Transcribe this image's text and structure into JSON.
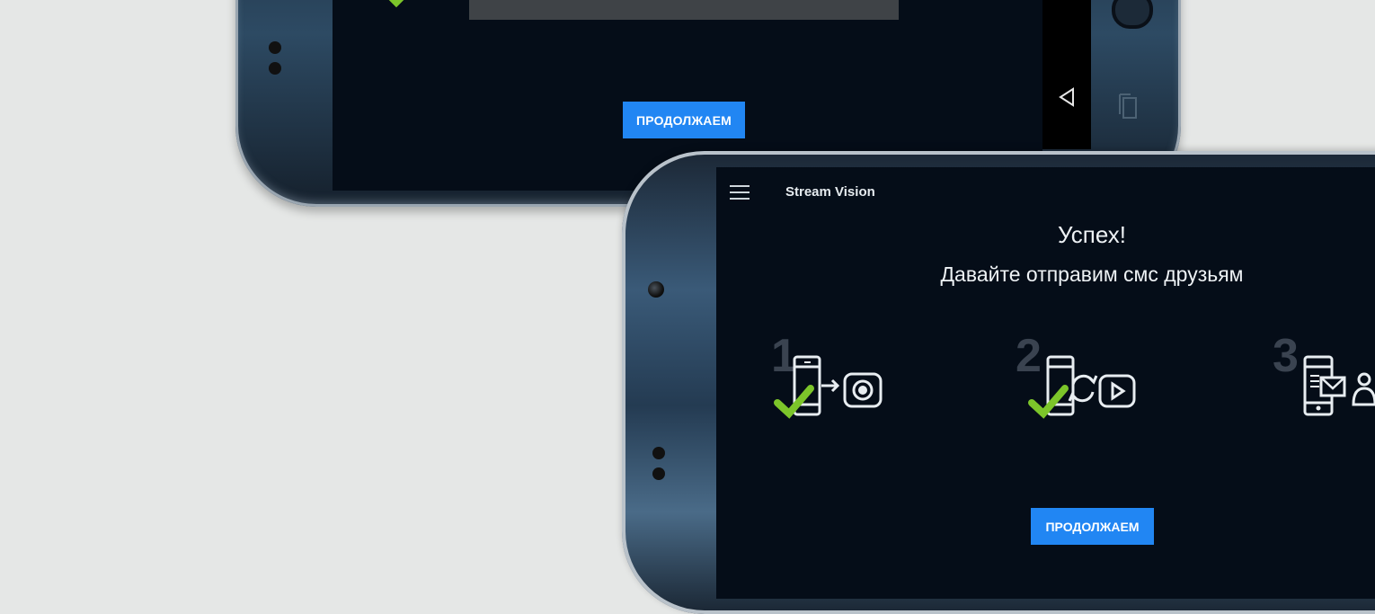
{
  "back_phone": {
    "continue_label": "ПРОДОЛЖАЕМ"
  },
  "front_phone": {
    "app_title": "Stream Vision",
    "heading": "Успех!",
    "subheading": "Давайте отправим смс друзьям",
    "steps": [
      {
        "number": "1",
        "icon": "phone-to-camera-icon",
        "done": true
      },
      {
        "number": "2",
        "icon": "phone-sync-video-icon",
        "done": true
      },
      {
        "number": "3",
        "icon": "phone-sms-contact-icon",
        "done": false
      }
    ],
    "continue_label": "ПРОДОЛЖАЕМ"
  },
  "colors": {
    "accent": "#2186f3",
    "check": "#7cc52a",
    "screen_bg": "#050d18",
    "page_bg": "#e5e7e6"
  }
}
